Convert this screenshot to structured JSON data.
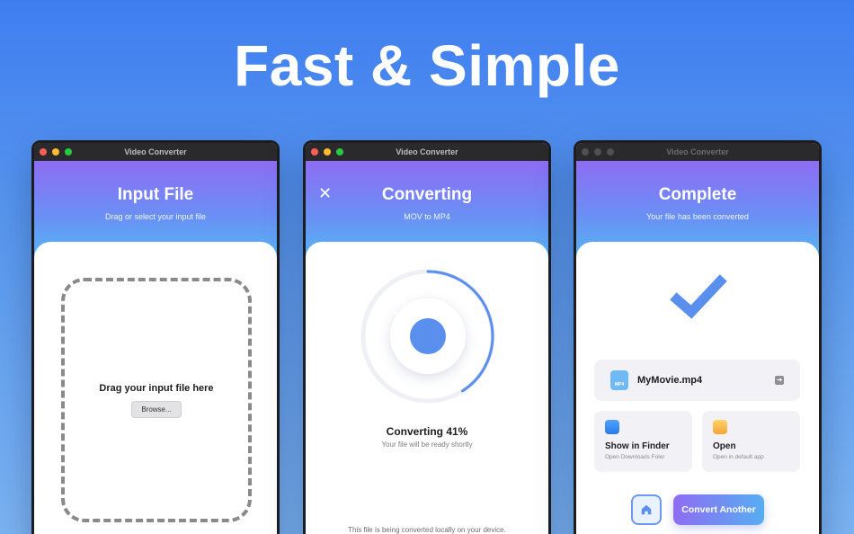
{
  "headline": "Fast & Simple",
  "windows": [
    {
      "window_title": "Video Converter",
      "title": "Input File",
      "subtitle": "Drag or select your input file",
      "drop_text": "Drag your input file here",
      "browse_label": "Browse..."
    },
    {
      "window_title": "Video Converter",
      "title": "Converting",
      "subtitle": "MOV to MP4",
      "close_glyph": "✕",
      "progress_fraction": 0.41,
      "status": "Converting 41%",
      "status_sub": "Your file will be ready shortly",
      "footer": "This file is being converted locally on your device."
    },
    {
      "window_title": "Video Converter",
      "title": "Complete",
      "subtitle": "Your file has been converted",
      "file_name": "MyMovie.mp4",
      "file_badge": "MP4",
      "file_arrow": "➔",
      "finder_title": "Show in Finder",
      "finder_sub": "Open Downloads Foler",
      "open_title": "Open",
      "open_sub": "Open in default app",
      "convert_another": "Convert Another"
    }
  ],
  "colors": {
    "accent_blue": "#5b8fee",
    "progress_track": "#eef0f5",
    "header_gradient_start": "#8e6cf4",
    "header_gradient_end": "#55b6f3"
  }
}
